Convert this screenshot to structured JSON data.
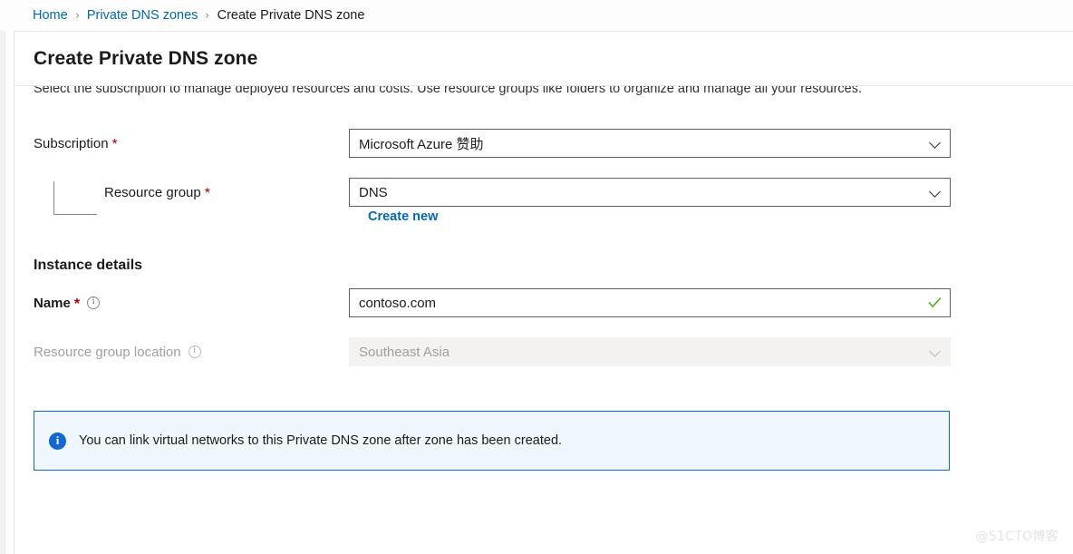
{
  "breadcrumb": {
    "items": [
      {
        "label": "Home",
        "current": false
      },
      {
        "label": "Private DNS zones",
        "current": false
      },
      {
        "label": "Create Private DNS zone",
        "current": true
      }
    ],
    "separator": "›"
  },
  "blade": {
    "title": "Create Private DNS zone"
  },
  "form": {
    "project_description": "Select the subscription to manage deployed resources and costs. Use resource groups like folders to organize and manage all your resources.",
    "subscription": {
      "label": "Subscription",
      "required_mark": "*",
      "value": "Microsoft Azure 赞助",
      "chevron_icon": "chevron-down-icon"
    },
    "resource_group": {
      "label": "Resource group",
      "required_mark": "*",
      "value": "DNS",
      "create_new_label": "Create new",
      "chevron_icon": "chevron-down-icon"
    },
    "instance_details": {
      "heading": "Instance details",
      "name": {
        "label": "Name",
        "required_mark": "*",
        "info_icon": "info-icon",
        "value": "contoso.com",
        "placeholder": "",
        "validation_icon": "green-checkmark-icon",
        "validation_color": "#5ab22a"
      },
      "resource_group_location": {
        "label": "Resource group location",
        "info_icon": "info-icon",
        "value": "Southeast Asia",
        "disabled": true,
        "chevron_icon": "chevron-down-icon"
      }
    }
  },
  "info_banner": {
    "icon": "info-filled-icon",
    "text": "You can link virtual networks to this Private DNS zone after zone has been created.",
    "background": "#eff6fc",
    "border_color": "#1368ce"
  },
  "watermark": {
    "text": "@51CTO博客"
  },
  "theme": {
    "link_color": "#0067b8",
    "required_color": "#a80000",
    "text_color": "#1b1b1b",
    "disabled_text": "#a19f9d"
  }
}
